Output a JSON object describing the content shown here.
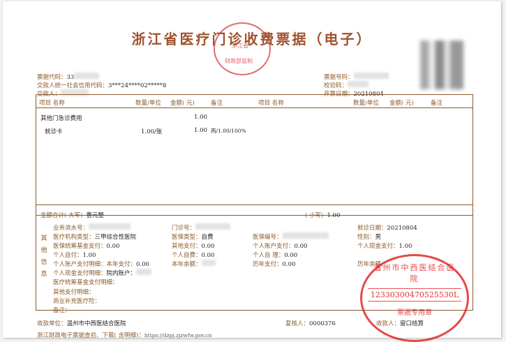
{
  "receipt": {
    "title": "浙江省医疗门诊收费票据（电子）",
    "stamp_top": {
      "line1": "浙江省",
      "line2": "财政部监制"
    },
    "header_left": {
      "bill_code_label": "票据代码：",
      "bill_code_value": "33",
      "payer_label": "交款人统一社会信用代码：",
      "payer_code_value": "3***24****02*****8",
      "payer_name_label": "交款人："
    },
    "header_right": {
      "bill_no_label": "票据号码：",
      "bill_no_value": "",
      "check_code_label": "校验码：",
      "check_code_value": "",
      "issue_date_label": "开票日期：",
      "issue_date_value": "20210804"
    },
    "columns": {
      "item": "项目 名称",
      "qty_unit": "数量/单位",
      "amount": "金额( 元)",
      "remark": "备注"
    },
    "items": [
      {
        "name": "其他门急诊费用",
        "qty": "",
        "amount": "1.00",
        "remark": ""
      },
      {
        "name": "就诊卡",
        "qty": "1.00/张",
        "amount": "1.00",
        "remark": "丙/1.00/100%"
      }
    ],
    "total": {
      "upper_label": "金额合计( 大写)",
      "upper_value": "壹元整",
      "lower_label": "( 小写)",
      "lower_value": "1.00"
    },
    "side_label": [
      "其",
      "他",
      "信",
      "息"
    ],
    "other_info": {
      "serial_label": "业务流水号：",
      "clinic_no_label": "门诊号：",
      "visit_date_label": "就诊日期：",
      "visit_date_value": "20210804",
      "inst_type_label": "医疗机构类型：",
      "inst_type_value": "三甲综合性医院",
      "insurance_type_label": "医保类型：",
      "insurance_type_value": "自费",
      "insurance_no_label": "医保编号：",
      "gender_label": "性别：",
      "gender_value": "男",
      "fund_pay_label": "医保统筹基金支付：",
      "fund_pay_value": "0.00",
      "other_pay_label": "其他支付：",
      "other_pay_value": "0.00",
      "account_pay_label": "个人账户支付：",
      "account_pay_value": "0.00",
      "cash_pay_label": "个人现金支付：",
      "cash_pay_value": "1.00",
      "self_pay_label": "个人自付：",
      "self_pay_value": "1.00",
      "self_burden_label": "个人自费：",
      "self_burden_value": "0.00",
      "self_handle_label": "个人自 理：",
      "self_handle_value": "0.00",
      "acct_year_label": "个人账户支付明细：本年支付：",
      "acct_year_value": "0.00",
      "balance_label": "本年余额：",
      "prev_year_label": "历年支付：",
      "prev_year_value": "0.00",
      "prev_balance_label": "历年余额：",
      "cash_detail_label": "个人现金支付明细：",
      "cash_detail_value": "院内账户：",
      "fund_detail_label": "医疗统筹基金支付明细：",
      "other_detail_label": "其他支付明细：",
      "commercial_label": "商业补充医疗险：",
      "note_label": "备注："
    },
    "footer": {
      "payee_unit_label": "收款单位：",
      "payee_unit_value": "温州市中西医结合医院",
      "reviewer_label": "复核人：",
      "reviewer_value": "0000376",
      "collector_label": "收款人：",
      "collector_value": "窗口结算",
      "note_label": "浙江财政电子票据查验、下载( 含明细)：",
      "note_value": "https://dzpj.zjzwfw.gov.cn"
    },
    "stamp_bottom": {
      "arc": "温州市中西医结合医院",
      "code": "12330300470525530L",
      "bottom": "票据专用章"
    }
  }
}
